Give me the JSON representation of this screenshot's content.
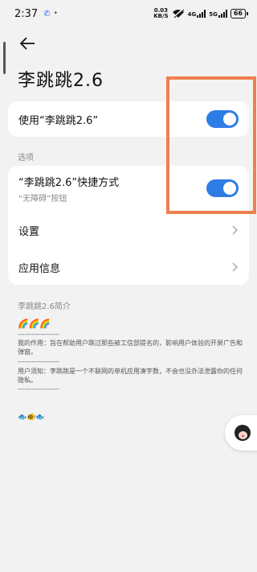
{
  "status": {
    "time": "2:37",
    "speed_value": "0.03",
    "speed_unit": "KB/S",
    "net1": "4G",
    "net2": "5G",
    "battery": "66"
  },
  "page": {
    "title": "李跳跳2.6"
  },
  "main_toggle": {
    "label": "使用“李跳跳2.6”",
    "on": true
  },
  "options": {
    "section_label": "选项",
    "shortcut_label": "“李跳跳2.6”快捷方式",
    "shortcut_sub": "“无障碍”按钮",
    "shortcut_on": true,
    "settings_label": "设置",
    "app_info_label": "应用信息"
  },
  "description": {
    "section_label": "李跳跳2.6简介",
    "emoji_top": "🌈🌈🌈",
    "divider": "------------------",
    "purpose": "我的作用：旨在帮助用户跳过那些被工信部提名的，影响用户体验的开屏广告和弹窗。",
    "notice": "用户须知：李跳跳是一个不联网的单机应用凑字数，不会也没办法泄露你的任何隐私。",
    "emoji_bottom": "🐟🐠🐟"
  },
  "colors": {
    "toggle_on": "#2e7ce6",
    "highlight": "#f07f4f"
  }
}
